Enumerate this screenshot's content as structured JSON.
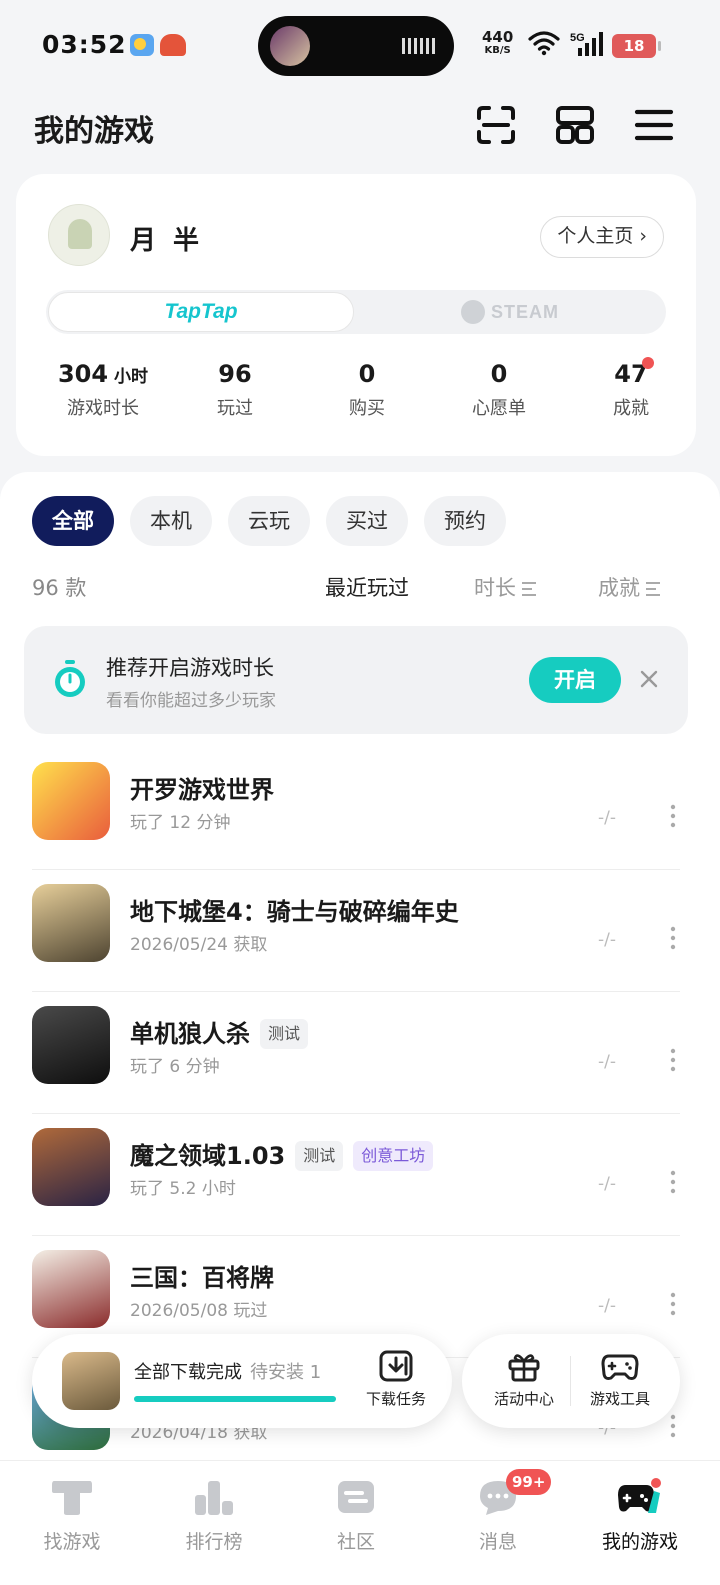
{
  "status_bar": {
    "time": "03:52",
    "net_speed": "440",
    "net_unit": "KB/S",
    "network": "5G",
    "battery": "18"
  },
  "header": {
    "title": "我的游戏"
  },
  "profile": {
    "username": "月 半",
    "home_button": "个人主页 ›",
    "platform_taptap": "TapTap",
    "platform_steam": "STEAM",
    "stats": [
      {
        "value": "304",
        "unit": "小时",
        "label": "游戏时长"
      },
      {
        "value": "96",
        "label": "玩过"
      },
      {
        "value": "0",
        "label": "购买"
      },
      {
        "value": "0",
        "label": "心愿单"
      },
      {
        "value": "47",
        "label": "成就"
      }
    ]
  },
  "filters": {
    "chips": [
      "全部",
      "本机",
      "云玩",
      "买过",
      "预约"
    ]
  },
  "sort": {
    "count": "96 款",
    "recent": "最近玩过",
    "duration": "时长",
    "achievement": "成就"
  },
  "promo": {
    "title": "推荐开启游戏时长",
    "subtitle": "看看你能超过多少玩家",
    "button": "开启"
  },
  "games": [
    {
      "name": "开罗游戏世界",
      "sub": "玩了 12 分钟",
      "dash": "-/-"
    },
    {
      "name": "地下城堡4：骑士与破碎编年史",
      "sub": "2026/05/24 获取",
      "dash": "-/-"
    },
    {
      "name": "单机狼人杀",
      "tag": "测试",
      "sub": "玩了 6 分钟",
      "dash": "-/-"
    },
    {
      "name": "魔之领域1.03",
      "tag": "测试",
      "tag2": "创意工坊",
      "sub": "玩了 5.2 小时",
      "dash": "-/-"
    },
    {
      "name": "三国：百将牌",
      "sub": "2026/05/08 玩过",
      "dash": "-/-"
    },
    {
      "name": "",
      "sub": "2026/04/18 获取",
      "dash": "-/-"
    }
  ],
  "download": {
    "status": "全部下载完成",
    "pending": "待安装 1",
    "progress": 1.0,
    "task_label": "下载任务"
  },
  "tools": {
    "activity": "活动中心",
    "game_tools": "游戏工具"
  },
  "nav": {
    "items": [
      "找游戏",
      "排行榜",
      "社区",
      "消息",
      "我的游戏"
    ],
    "message_badge": "99+"
  },
  "colors": {
    "accent": "#16ccc0",
    "chip_active": "#111c5c",
    "badge": "#f05454"
  }
}
